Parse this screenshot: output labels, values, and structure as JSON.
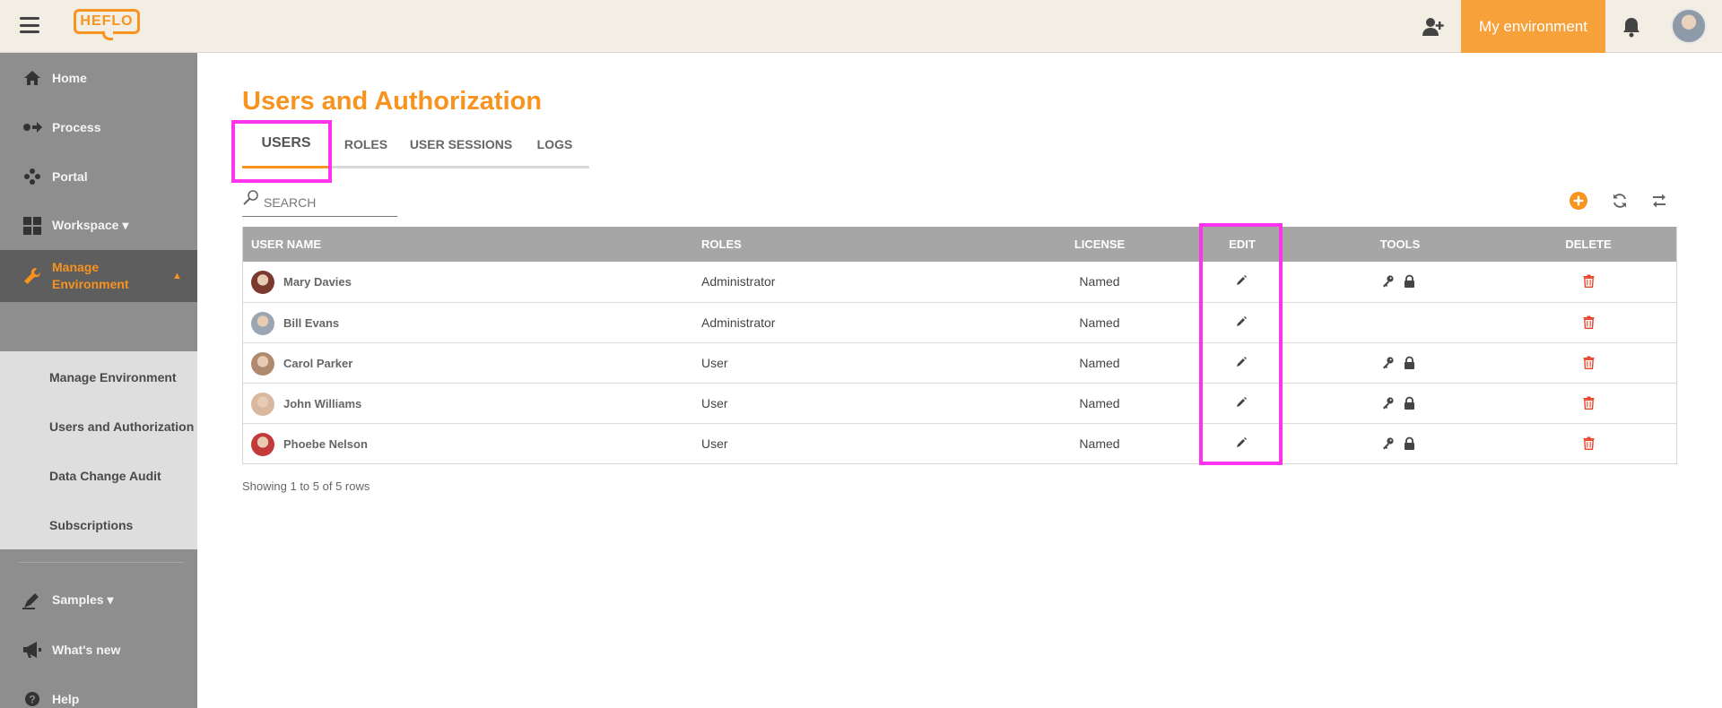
{
  "header": {
    "logo_text": "HEFLO",
    "environment_button": "My environment",
    "icons": [
      "menu-icon",
      "add-user-icon",
      "bell-icon",
      "avatar"
    ]
  },
  "sidebar": {
    "items": [
      {
        "label": "Home",
        "icon": "home-icon"
      },
      {
        "label": "Process",
        "icon": "process-icon"
      },
      {
        "label": "Portal",
        "icon": "portal-icon"
      },
      {
        "label": "Workspace ▾",
        "icon": "workspace-icon"
      },
      {
        "label": "Manage Environment",
        "icon": "wrench-icon",
        "active": true
      },
      {
        "label": "Samples ▾",
        "icon": "samples-icon"
      },
      {
        "label": "What's new",
        "icon": "megaphone-icon"
      },
      {
        "label": "Help",
        "icon": "help-icon"
      }
    ],
    "active_caret": "▲",
    "submenu": [
      "Manage Environment",
      "Users and Authorization",
      "Data Change Audit",
      "Subscriptions"
    ]
  },
  "main": {
    "title": "Users and Authorization",
    "tabs": [
      "USERS",
      "ROLES",
      "USER SESSIONS",
      "LOGS"
    ],
    "search": {
      "placeholder": "SEARCH",
      "value": ""
    },
    "table": {
      "columns": [
        "USER NAME",
        "ROLES",
        "LICENSE",
        "EDIT",
        "TOOLS",
        "DELETE"
      ],
      "rows": [
        {
          "name": "Mary Davies",
          "role": "Administrator",
          "license": "Named",
          "tools": true
        },
        {
          "name": "Bill Evans",
          "role": "Administrator",
          "license": "Named",
          "tools": false
        },
        {
          "name": "Carol Parker",
          "role": "User",
          "license": "Named",
          "tools": true
        },
        {
          "name": "John Williams",
          "role": "User",
          "license": "Named",
          "tools": true
        },
        {
          "name": "Phoebe Nelson",
          "role": "User",
          "license": "Named",
          "tools": true
        }
      ]
    },
    "footer": "Showing 1 to 5 of 5 rows"
  },
  "colors": {
    "accent": "#f7931e",
    "highlight": "#ff33ee",
    "delete": "#e8452b",
    "avatars": [
      "#7a3b2e",
      "#9aa6b2",
      "#b08a6e",
      "#d8b9a0",
      "#c23a3a"
    ]
  }
}
